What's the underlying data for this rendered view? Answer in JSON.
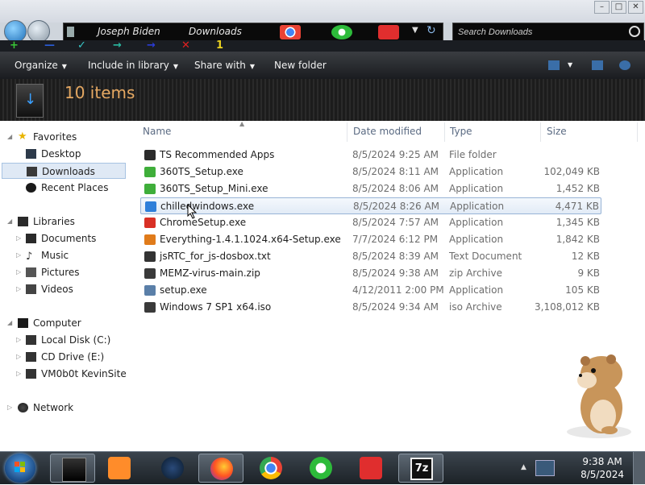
{
  "window": {
    "minimize": "–",
    "restore": "□",
    "close": "✕"
  },
  "address": {
    "path": [
      "Joseph Biden",
      "Downloads"
    ]
  },
  "search": {
    "placeholder": "Search Downloads"
  },
  "strip": {
    "plus": "+",
    "minus": "—",
    "check": "✓",
    "arrow": "→",
    "arrow2": "→",
    "x": "✕",
    "one": "1"
  },
  "toolbar": {
    "organize": "Organize",
    "include": "Include in library",
    "share": "Share with",
    "new_folder": "New folder"
  },
  "header": {
    "item_count": "10 items"
  },
  "sidebar": {
    "favorites": "Favorites",
    "desktop": "Desktop",
    "downloads": "Downloads",
    "recent": "Recent Places",
    "libraries": "Libraries",
    "documents": "Documents",
    "music": "Music",
    "pictures": "Pictures",
    "videos": "Videos",
    "computer": "Computer",
    "local_disk": "Local Disk (C:)",
    "cd_drive": "CD Drive (E:)",
    "vm": "VM0b0t KevinSite",
    "network": "Network"
  },
  "columns": {
    "name": "Name",
    "date": "Date modified",
    "type": "Type",
    "size": "Size"
  },
  "files": [
    {
      "name": "TS Recommended Apps",
      "date": "8/5/2024 9:25 AM",
      "type": "File folder",
      "size": "",
      "icon": "folder-icon",
      "color": "#2b2b2b"
    },
    {
      "name": "360TS_Setup.exe",
      "date": "8/5/2024 8:11 AM",
      "type": "Application",
      "size": "102,049 KB",
      "icon": "360-icon",
      "color": "#3fae3a"
    },
    {
      "name": "360TS_Setup_Mini.exe",
      "date": "8/5/2024 8:06 AM",
      "type": "Application",
      "size": "1,452 KB",
      "icon": "360-icon",
      "color": "#3fae3a"
    },
    {
      "name": "chilledwindows.exe",
      "date": "8/5/2024 8:26 AM",
      "type": "Application",
      "size": "4,471 KB",
      "icon": "windows-logo-icon",
      "color": "#2f7fd9"
    },
    {
      "name": "ChromeSetup.exe",
      "date": "8/5/2024 7:57 AM",
      "type": "Application",
      "size": "1,345 KB",
      "icon": "chrome-icon",
      "color": "#d93025"
    },
    {
      "name": "Everything-1.4.1.1024.x64-Setup.exe",
      "date": "7/7/2024 6:12 PM",
      "type": "Application",
      "size": "1,842 KB",
      "icon": "everything-icon",
      "color": "#e07b1a"
    },
    {
      "name": "jsRTC_for_js-dosbox.txt",
      "date": "8/5/2024 8:39 AM",
      "type": "Text Document",
      "size": "12 KB",
      "icon": "text-document-icon",
      "color": "#333333"
    },
    {
      "name": "MEMZ-virus-main.zip",
      "date": "8/5/2024 9:38 AM",
      "type": "zip Archive",
      "size": "9 KB",
      "icon": "zip-archive-icon",
      "color": "#3a3a3a"
    },
    {
      "name": "setup.exe",
      "date": "4/12/2011 2:00 PM",
      "type": "Application",
      "size": "105 KB",
      "icon": "setup-icon",
      "color": "#5a7fa8"
    },
    {
      "name": "Windows 7 SP1 x64.iso",
      "date": "8/5/2024 9:34 AM",
      "type": "iso Archive",
      "size": "3,108,012 KB",
      "icon": "iso-archive-icon",
      "color": "#3a3a3a"
    }
  ],
  "taskbar": {
    "apps": [
      "explorer-icon",
      "media-player-icon",
      "globe-icon",
      "firefox-icon",
      "chrome-icon",
      "360-browser-icon",
      "wps-office-icon",
      "7zip-icon"
    ],
    "seven_zip_label": "7z",
    "time": "9:38 AM",
    "date": "8/5/2024"
  },
  "colors": {
    "accent": "#e5a862",
    "selection_border": "#98b4d6",
    "toolbar_bg": "#26292e"
  }
}
